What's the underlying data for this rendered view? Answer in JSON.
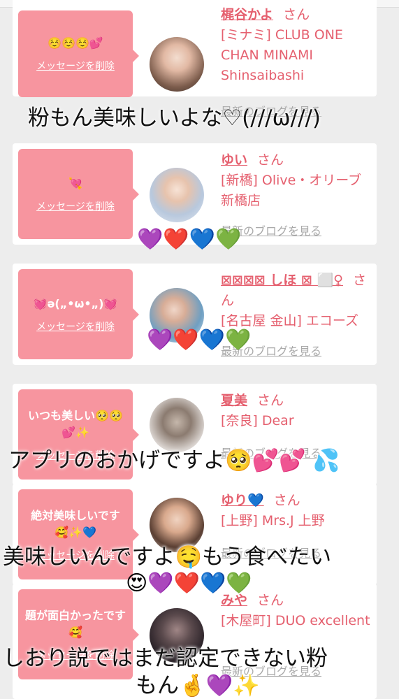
{
  "delete_label": "メッセージを削除",
  "blog_label": "最新のブログを見る",
  "san_label": "さん",
  "cards": [
    {
      "message": "☺️☺️☺️💕",
      "name": "梶谷かよ",
      "shop": "[ミナミ] CLUB ONE CHAN MINAMI Shinsaibashi"
    },
    {
      "message": "💘",
      "name": "ゆい",
      "shop": "[新橋] Olive・オリーブ 新橋店"
    },
    {
      "message": "💓ə(„•ω•„)💓",
      "name": "⊠⊠⊠⊠ しほ ⊠ ⬜♀",
      "shop": "[名古屋 金山] エコーズ"
    },
    {
      "message": "いつも美しい🥺🥺💕✨",
      "name": "夏美",
      "shop": "[奈良] Dear"
    },
    {
      "message": "絶対美味しいです🥰✨💙",
      "name": "ゆり💙",
      "shop": "[上野] Mrs.J 上野"
    },
    {
      "message": "題が面白かったです🥰",
      "name": "みや",
      "shop": "[木屋町] DUO excellent"
    }
  ],
  "overlays": {
    "line1": "粉もん美味しいよな♡(///ω///)",
    "hearts1": "💜❤️💙💚",
    "hearts2": "💜❤️💙💚",
    "line2": "アプリのおかげですよ🥺💕💕 💦",
    "line3": "美味しいんですよ🤤もう食べたい",
    "hearts3": "😍💜❤️💙💚",
    "line4": "しおり説ではまだ認定できない粉",
    "line5": "もん🤞💜✨"
  }
}
